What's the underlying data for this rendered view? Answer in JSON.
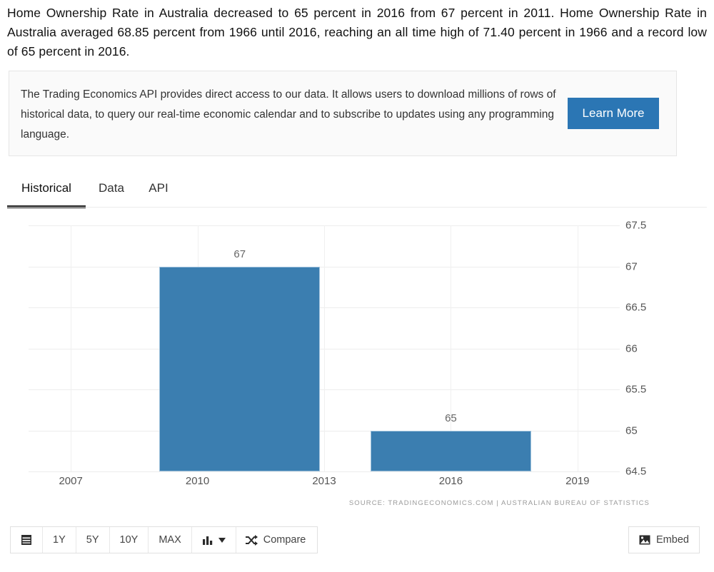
{
  "intro": {
    "text": "Home Ownership Rate in Australia decreased to 65 percent in 2016 from 67 percent in 2011. Home Ownership Rate in Australia averaged 68.85 percent from 1966 until 2016, reaching an all time high of 71.40 percent in 1966 and a record low of 65 percent in 2016."
  },
  "promo": {
    "text": "The Trading Economics API provides direct access to our data. It allows users to download millions of rows of historical data, to query our real-time economic calendar and to subscribe to updates using any programming language.",
    "button_label": "Learn More",
    "button_color": "#2b76b4"
  },
  "tabs": {
    "items": [
      {
        "label": "Historical",
        "active": true
      },
      {
        "label": "Data",
        "active": false
      },
      {
        "label": "API",
        "active": false
      }
    ]
  },
  "chart_data": {
    "type": "bar",
    "title": "",
    "xlabel": "",
    "ylabel": "",
    "categories": [
      "2011",
      "2016"
    ],
    "values": [
      67,
      65
    ],
    "bar_labels": [
      "67",
      "65"
    ],
    "x_positions": [
      2011,
      2016
    ],
    "xlim": [
      2006,
      2020
    ],
    "ylim": [
      64.5,
      67.5
    ],
    "ytick_labels": [
      "67.5",
      "67",
      "66.5",
      "66",
      "65.5",
      "65",
      "64.5"
    ],
    "ytick_values": [
      67.5,
      67,
      66.5,
      66,
      65.5,
      65,
      64.5
    ],
    "xtick_labels": [
      "2007",
      "2010",
      "2013",
      "2016",
      "2019"
    ],
    "xtick_values": [
      2007,
      2010,
      2013,
      2016,
      2019
    ],
    "bar_color": "#3b7eb0",
    "grid": true,
    "legend": "none",
    "source": "SOURCE: TRADINGECONOMICS.COM  |  AUSTRALIAN BUREAU OF STATISTICS"
  },
  "toolbar": {
    "calendar_label": "",
    "ranges": [
      "1Y",
      "5Y",
      "10Y",
      "MAX"
    ],
    "charttype_label": "",
    "compare_label": "Compare",
    "embed_label": "Embed"
  }
}
